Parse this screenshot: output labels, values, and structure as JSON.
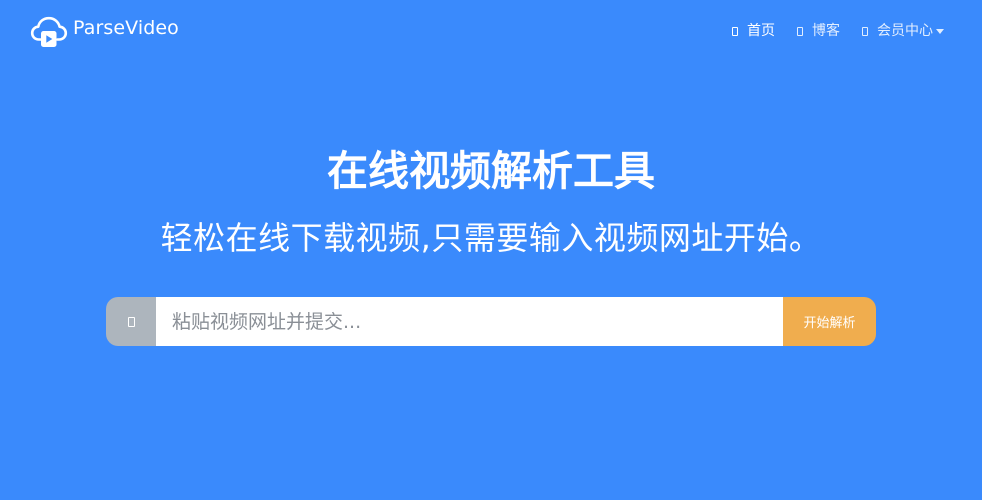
{
  "brand": {
    "name": "ParseVideo"
  },
  "nav": {
    "items": [
      {
        "label": "首页",
        "icon": "page-icon",
        "active": true
      },
      {
        "label": "博客",
        "icon": "page-icon",
        "active": false
      },
      {
        "label": "会员中心",
        "icon": "page-icon",
        "active": false,
        "dropdown": true
      }
    ]
  },
  "hero": {
    "title": "在线视频解析工具",
    "subtitle": "轻松在线下载视频,只需要输入视频网址开始。"
  },
  "search": {
    "addon_icon": "link-icon",
    "value": "",
    "placeholder": "粘贴视频网址并提交...",
    "button_label": "开始解析"
  },
  "colors": {
    "background": "#3a8afc",
    "button": "#f0ad4e",
    "addon": "#adb5bd"
  }
}
